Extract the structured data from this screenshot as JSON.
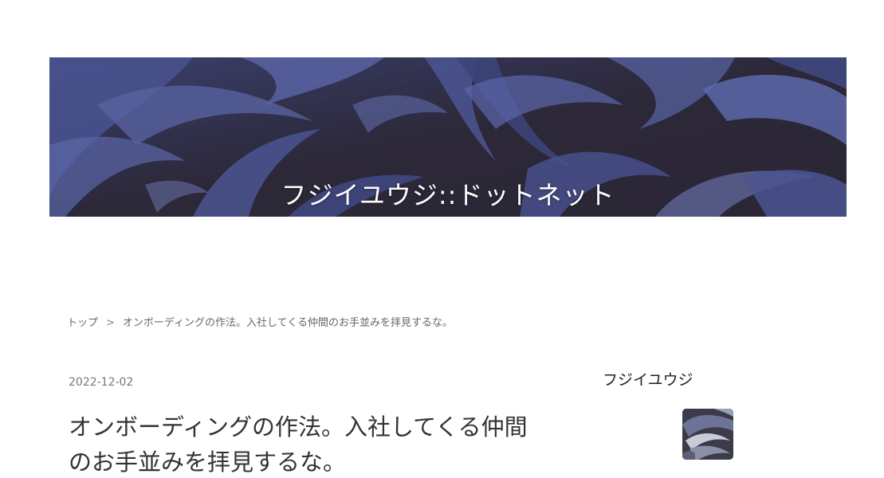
{
  "header": {
    "site_title": "フジイユウジ::ドットネット",
    "banner_icon": "indigo-foliage-pattern",
    "colors": {
      "banner_dark": "#2f2b40",
      "banner_blue": "#4b5592",
      "banner_light": "#6f7bb8"
    }
  },
  "breadcrumb": {
    "home_label": "トップ",
    "separator": ">",
    "current_label": "オンボーディングの作法。入社してくる仲間のお手並みを拝見するな。"
  },
  "article": {
    "date": "2022-12-02",
    "title": "オンボーディングの作法。入社してくる仲間のお手並みを拝見するな。"
  },
  "sidebar": {
    "author_name": "フジイユウジ",
    "avatar_icon": "author-avatar-pattern"
  }
}
